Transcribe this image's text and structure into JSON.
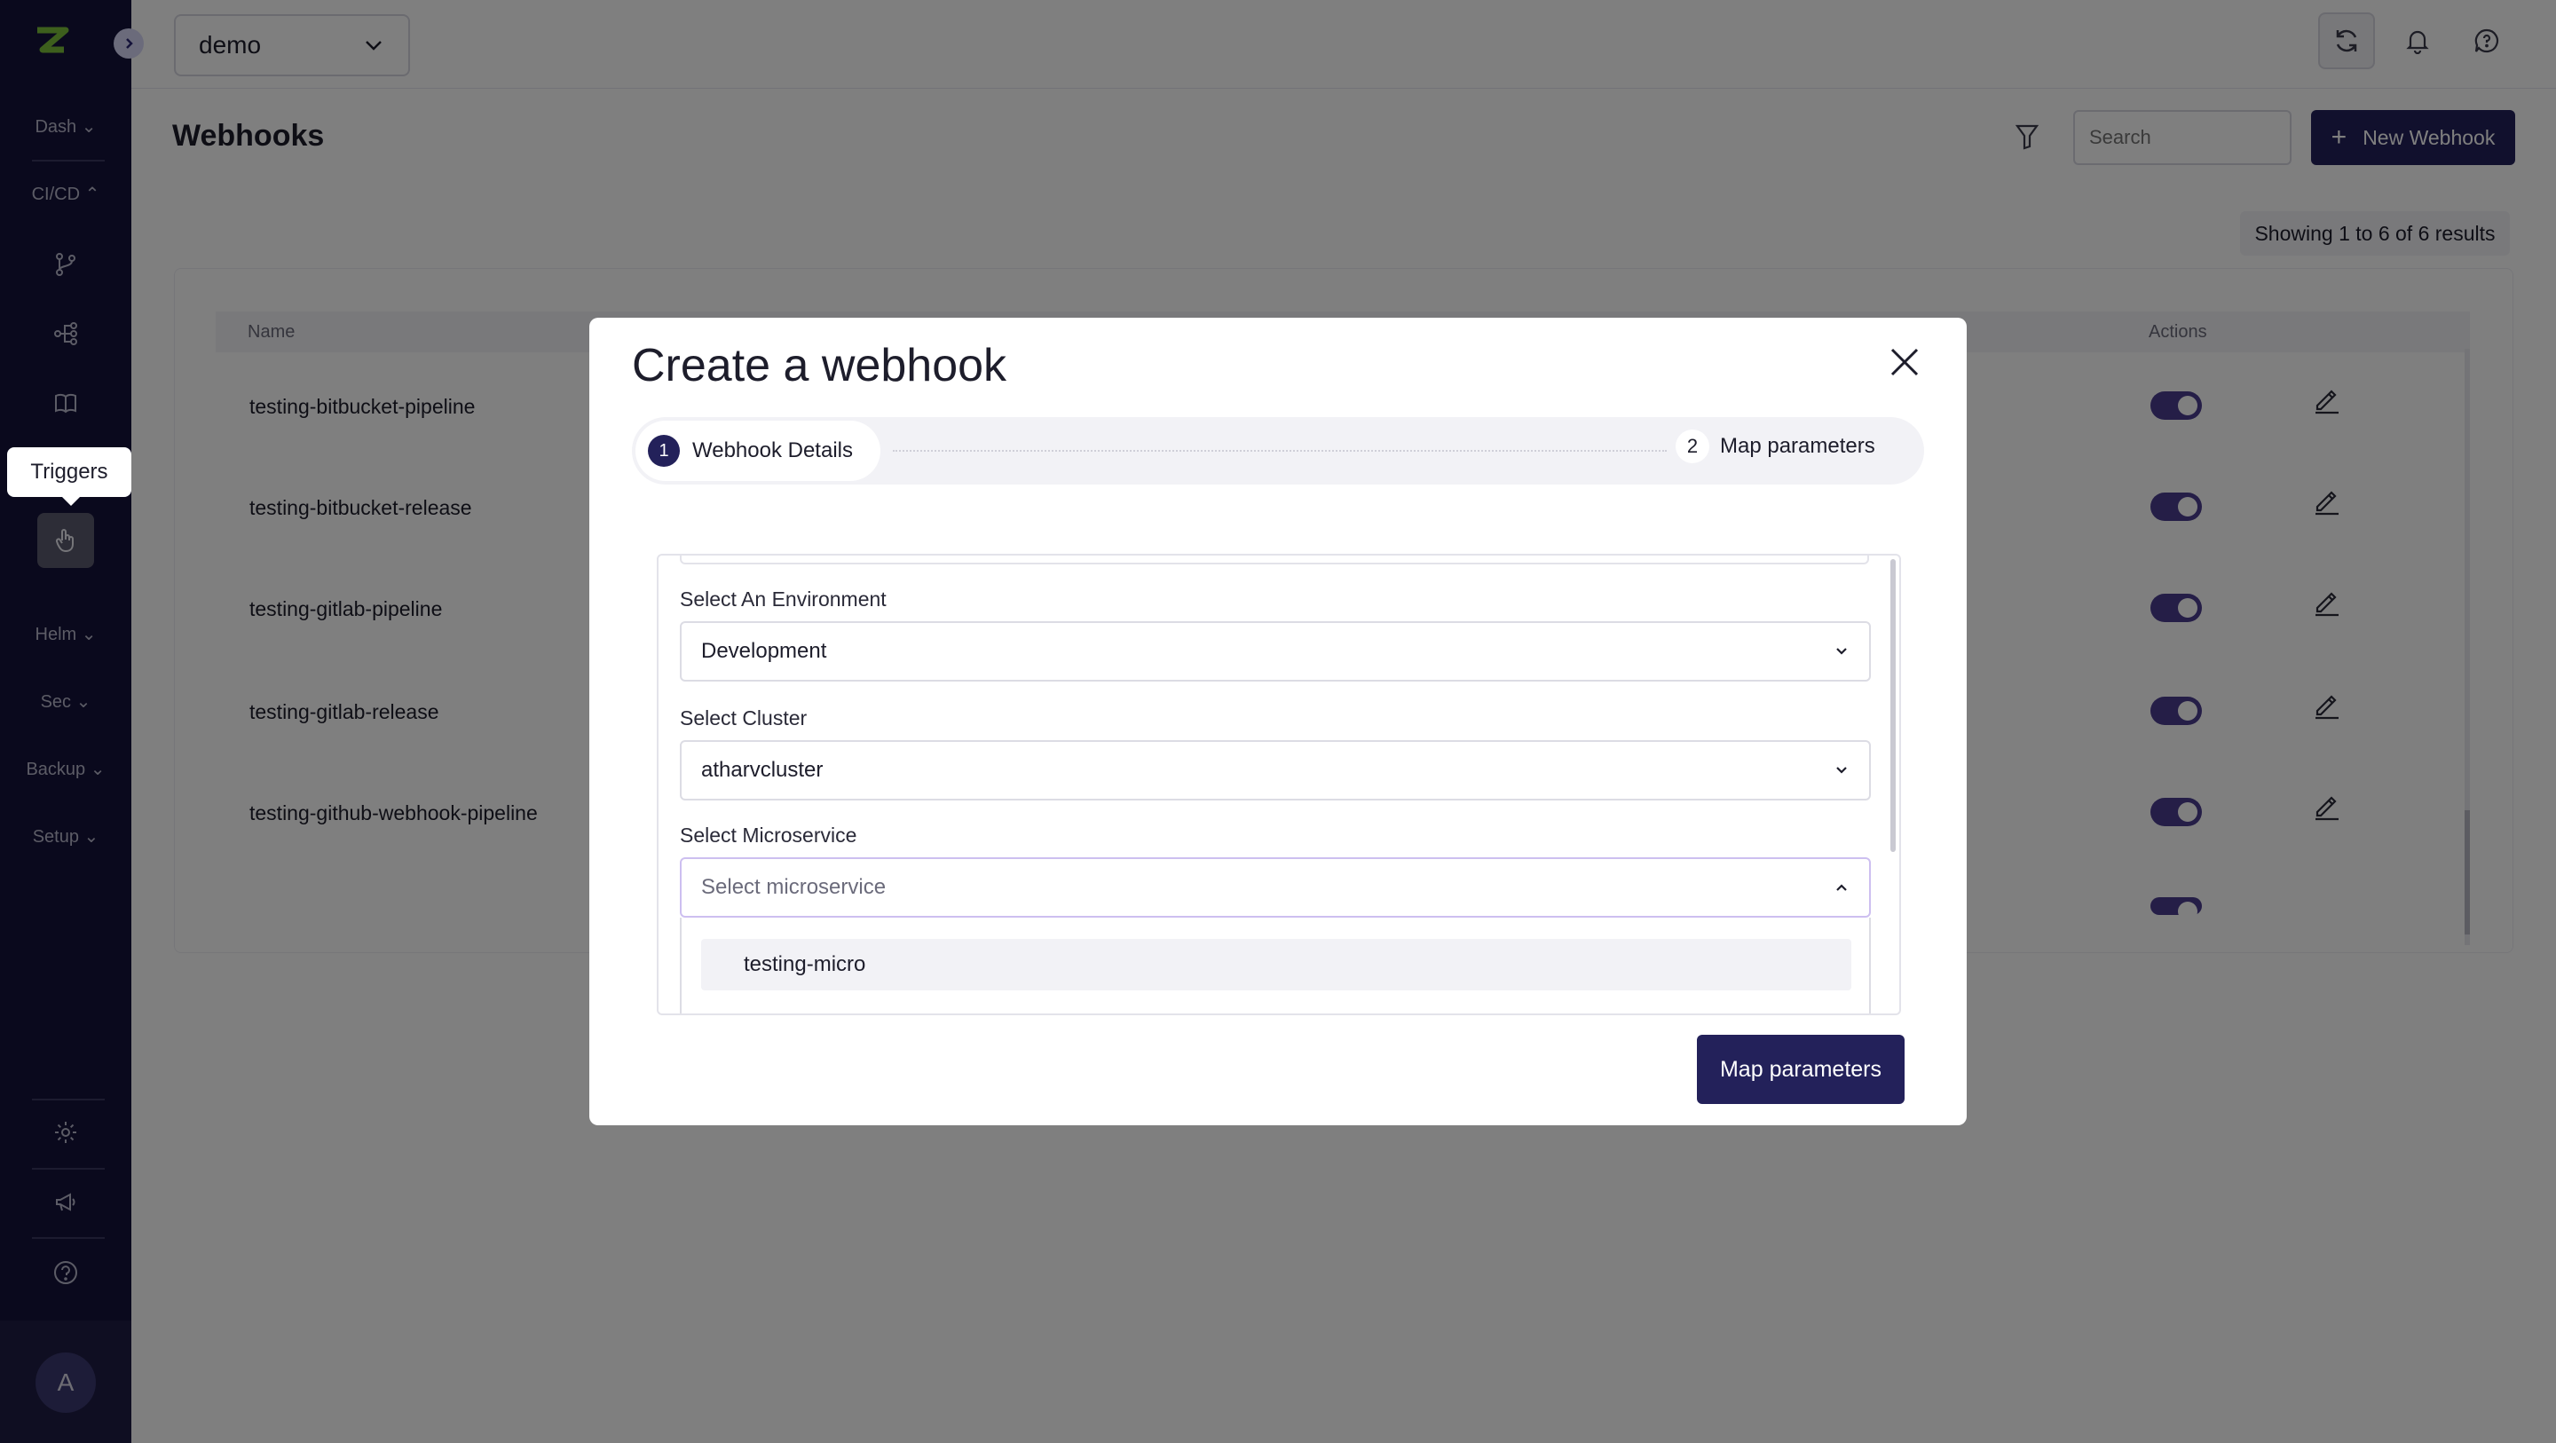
{
  "sidebar": {
    "items": [
      {
        "label": "Dash"
      },
      {
        "label": "CI/CD"
      },
      {
        "label": "Helm"
      },
      {
        "label": "Sec"
      },
      {
        "label": "Backup"
      },
      {
        "label": "Setup"
      }
    ],
    "tooltip": "Triggers",
    "avatar_initial": "A"
  },
  "topbar": {
    "workspace": "demo"
  },
  "page": {
    "title": "Webhooks",
    "search_placeholder": "Search",
    "new_button": "New Webhook",
    "results": "Showing 1 to 6 of 6 results"
  },
  "table": {
    "headers": {
      "name": "Name",
      "actions": "Actions"
    },
    "rows": [
      {
        "name": "testing-bitbucket-pipeline"
      },
      {
        "name": "testing-bitbucket-release"
      },
      {
        "name": "testing-gitlab-pipeline"
      },
      {
        "name": "testing-gitlab-release"
      },
      {
        "name": "testing-github-webhook-pipeline"
      }
    ]
  },
  "modal": {
    "title": "Create a webhook",
    "steps": [
      {
        "number": "1",
        "label": "Webhook Details"
      },
      {
        "number": "2",
        "label": "Map parameters"
      }
    ],
    "fields": {
      "environment_label": "Select An Environment",
      "environment_value": "Development",
      "cluster_label": "Select Cluster",
      "cluster_value": "atharvcluster",
      "microservice_label": "Select Microservice",
      "microservice_placeholder": "Select microservice"
    },
    "microservice_options": [
      "testing-micro"
    ],
    "submit_button": "Map parameters"
  },
  "colors": {
    "sidebar_bg": "#15133a",
    "primary": "#23215a",
    "toggle_on": "#4a3d8f",
    "logo_green": "#7bbf3a"
  }
}
